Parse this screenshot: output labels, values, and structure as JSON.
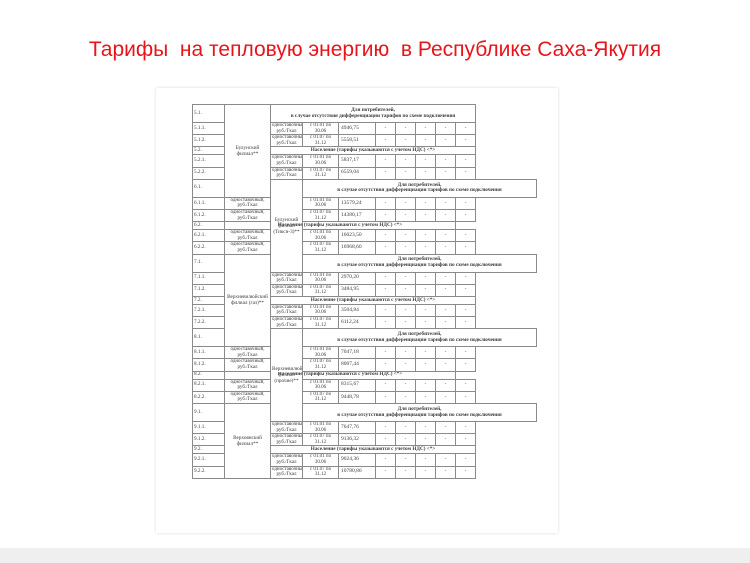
{
  "title": "Тарифы  на тепловую энергию  в Республике Саха-Якутия",
  "header_text": "Для потребителей,\nв случае отсутствия дифференциации тарифов по схеме подключения",
  "population_text": "Население (тарифы указываются с учетом НДС) <*>",
  "tariff_type": "одноставочный, руб./Гкал",
  "period_1": "с 01.01 по 30.06",
  "period_2": "с 01.07 по 31.12",
  "dash": "-",
  "sections": [
    {
      "num": "5.1.",
      "pop_num": "5.2.",
      "branch": "Булунский филиал**",
      "rows": [
        {
          "num": "5.1.1.",
          "value": "4946,75"
        },
        {
          "num": "5.1.2.",
          "value": "5558,51"
        }
      ],
      "pop_rows": [
        {
          "num": "5.2.1.",
          "value": "5837,17"
        },
        {
          "num": "5.2.2.",
          "value": "6559,04"
        }
      ]
    },
    {
      "num": "6.1.",
      "pop_num": "6.2.",
      "branch": "Булунский филиал (Тикси-3)**",
      "rows": [
        {
          "num": "6.1.1.",
          "value": "13579,24"
        },
        {
          "num": "6.1.2.",
          "value": "14380,17"
        }
      ],
      "pop_rows": [
        {
          "num": "6.2.1.",
          "value": "16023,50"
        },
        {
          "num": "6.2.2.",
          "value": "16968,60"
        }
      ]
    },
    {
      "num": "7.1.",
      "pop_num": "7.2.",
      "branch": "Верхневилюйский филиал (газ)**",
      "rows": [
        {
          "num": "7.1.1.",
          "value": "2970,20"
        },
        {
          "num": "7.1.2.",
          "value": "3484,95"
        }
      ],
      "pop_rows": [
        {
          "num": "7.2.1.",
          "value": "3504,84"
        },
        {
          "num": "7.2.2.",
          "value": "6112,24"
        }
      ]
    },
    {
      "num": "8.1.",
      "pop_num": "8.2.",
      "branch": "Верхневилюйский филиал (прочие)**",
      "rows": [
        {
          "num": "8.1.1.",
          "value": "7047,18"
        },
        {
          "num": "8.1.2.",
          "value": "8007,44"
        }
      ],
      "pop_rows": [
        {
          "num": "8.2.1.",
          "value": "8315,67"
        },
        {
          "num": "8.2.2.",
          "value": "9448,78"
        }
      ]
    },
    {
      "num": "9.1.",
      "pop_num": "9.2.",
      "branch": "Верхоянский филиал**",
      "rows": [
        {
          "num": "9.1.1.",
          "value": "7647,76"
        },
        {
          "num": "9.1.2.",
          "value": "9136,32"
        }
      ],
      "pop_rows": [
        {
          "num": "9.2.1.",
          "value": "9024,36"
        },
        {
          "num": "9.2.2.",
          "value": "10780,86"
        }
      ]
    }
  ]
}
